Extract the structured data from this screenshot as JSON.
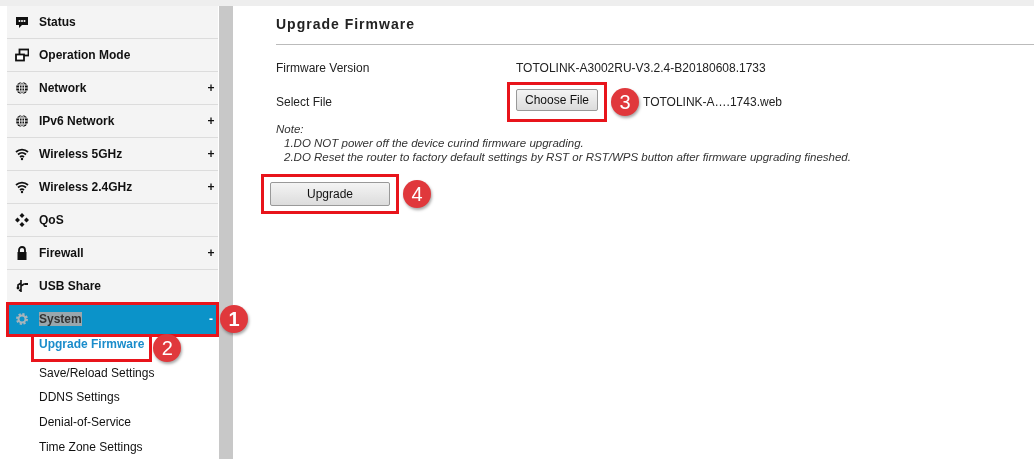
{
  "sidebar": {
    "items": [
      {
        "label": "Status",
        "selected": false
      },
      {
        "label": "Operation Mode",
        "selected": false
      },
      {
        "label": "Network",
        "expanded": false,
        "selected": false,
        "toggle": "+"
      },
      {
        "label": "IPv6 Network",
        "expanded": false,
        "selected": false,
        "toggle": "+"
      },
      {
        "label": "Wireless 5GHz",
        "expanded": false,
        "selected": false,
        "toggle": "+"
      },
      {
        "label": "Wireless 2.4GHz",
        "expanded": false,
        "selected": false,
        "toggle": "+"
      },
      {
        "label": "QoS",
        "selected": false
      },
      {
        "label": "Firewall",
        "expanded": false,
        "selected": false,
        "toggle": "+"
      },
      {
        "label": "USB Share",
        "selected": false
      },
      {
        "label": "System",
        "expanded": true,
        "selected": true,
        "toggle": "-",
        "callout": "1",
        "children": [
          {
            "label": "Upgrade Firmware",
            "selected": true,
            "callout": "2"
          },
          {
            "label": "Save/Reload Settings",
            "selected": false
          },
          {
            "label": "DDNS Settings",
            "selected": false
          },
          {
            "label": "Denial-of-Service",
            "selected": false
          },
          {
            "label": "Time Zone Settings",
            "selected": false
          }
        ]
      }
    ]
  },
  "page": {
    "title": "Upgrade Firmware",
    "fields": [
      {
        "label": "Firmware Version",
        "kind": "text",
        "value": "TOTOLINK-A3002RU-V3.2.4-B20180608.1733"
      },
      {
        "label": "Select File",
        "kind": "file",
        "button": "Choose File",
        "value": "TOTOLINK-A….1743.web",
        "callout": "3"
      }
    ],
    "note_title": "Note:",
    "notes": [
      "1.DO NOT power off the device curind firmware upgrading.",
      "2.DO Reset the router to factory default settings by RST or RST/WPS button after firmware upgrading fineshed."
    ],
    "submit": {
      "label": "Upgrade",
      "callout": "4"
    }
  }
}
